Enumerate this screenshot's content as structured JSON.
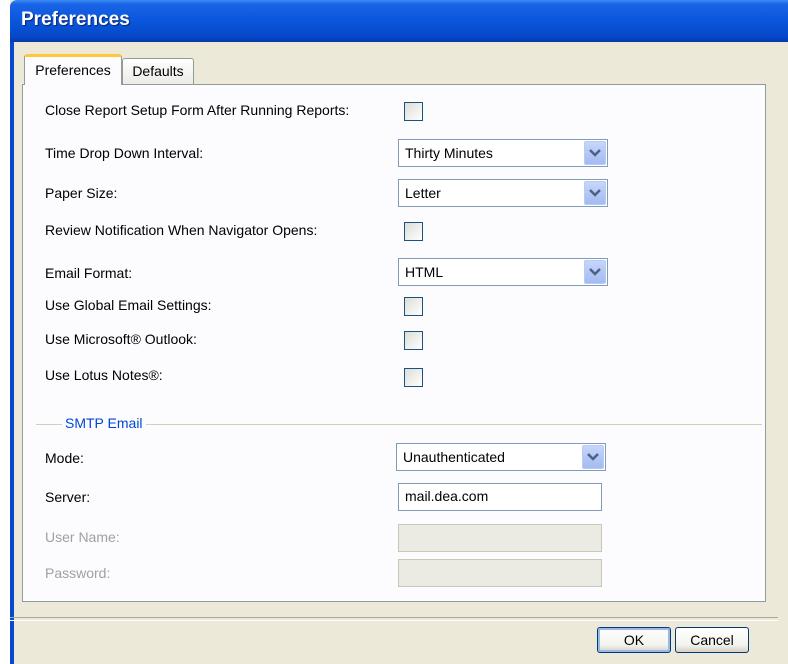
{
  "window": {
    "title": "Preferences"
  },
  "tabs": [
    {
      "label": "Preferences",
      "active": true
    },
    {
      "label": "Defaults",
      "active": false
    }
  ],
  "form": {
    "close_report": {
      "label": "Close Report Setup Form After Running Reports:",
      "checked": false
    },
    "time_interval": {
      "label": "Time Drop Down Interval:",
      "value": "Thirty Minutes"
    },
    "paper_size": {
      "label": "Paper Size:",
      "value": "Letter"
    },
    "review_notification": {
      "label": "Review Notification When Navigator Opens:",
      "checked": false
    },
    "email_format": {
      "label": "Email Format:",
      "value": "HTML"
    },
    "global_email": {
      "label": "Use Global Email Settings:",
      "checked": false
    },
    "outlook": {
      "label": "Use Microsoft® Outlook:",
      "checked": false
    },
    "lotus": {
      "label": "Use Lotus Notes®:",
      "checked": false
    }
  },
  "smtp": {
    "group_title": "SMTP Email",
    "mode": {
      "label": "Mode:",
      "value": "Unauthenticated"
    },
    "server": {
      "label": "Server:",
      "value": "mail.dea.com"
    },
    "username": {
      "label": "User Name:",
      "value": ""
    },
    "password": {
      "label": "Password:",
      "value": ""
    }
  },
  "buttons": {
    "ok": "OK",
    "cancel": "Cancel"
  },
  "colors": {
    "titlebar": "#0a56dc",
    "accent_tab": "#ffc83c",
    "group_title": "#0046d5"
  },
  "icons": {
    "dropdown": "chevron-down-icon"
  }
}
